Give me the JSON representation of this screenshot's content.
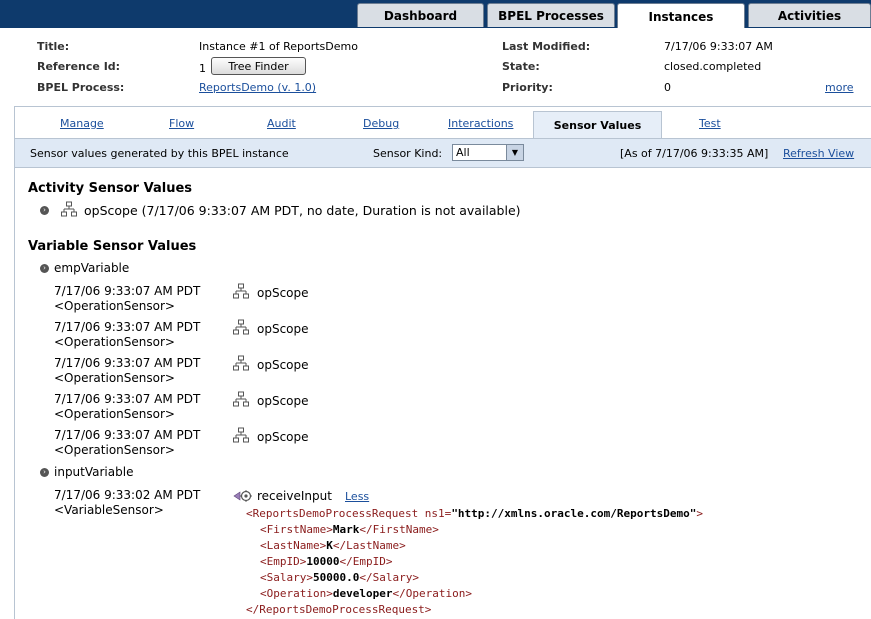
{
  "top_tabs": [
    {
      "label": "Dashboard"
    },
    {
      "label": "BPEL Processes"
    },
    {
      "label": "Instances"
    },
    {
      "label": "Activities"
    }
  ],
  "header": {
    "title_label": "Title:",
    "title_value": "Instance #1 of ReportsDemo",
    "ref_label": "Reference Id:",
    "ref_value": "1",
    "tree_finder": "Tree Finder",
    "process_label": "BPEL Process:",
    "process_value": "ReportsDemo (v. 1.0)",
    "modified_label": "Last Modified:",
    "modified_value": "7/17/06 9:33:07 AM",
    "state_label": "State:",
    "state_value": "closed.completed",
    "priority_label": "Priority:",
    "priority_value": "0",
    "more": "more"
  },
  "sub_tabs": [
    {
      "label": "Manage"
    },
    {
      "label": "Flow"
    },
    {
      "label": "Audit"
    },
    {
      "label": "Debug"
    },
    {
      "label": "Interactions"
    },
    {
      "label": "Sensor Values"
    },
    {
      "label": "Test"
    }
  ],
  "info": {
    "description": "Sensor values generated by this BPEL instance",
    "kind_label": "Sensor Kind:",
    "kind_value": "All",
    "as_of": "[As of 7/17/06 9:33:35 AM]",
    "refresh": "Refresh View"
  },
  "activity_section": {
    "heading": "Activity Sensor Values",
    "item": "opScope (7/17/06 9:33:07 AM PDT, no date, Duration is not available)"
  },
  "variable_section": {
    "heading": "Variable Sensor Values",
    "emp_var": "empVariable",
    "emp_rows": [
      {
        "time": "7/17/06 9:33:07 AM PDT",
        "type": "<OperationSensor>",
        "scope": "opScope"
      },
      {
        "time": "7/17/06 9:33:07 AM PDT",
        "type": "<OperationSensor>",
        "scope": "opScope"
      },
      {
        "time": "7/17/06 9:33:07 AM PDT",
        "type": "<OperationSensor>",
        "scope": "opScope"
      },
      {
        "time": "7/17/06 9:33:07 AM PDT",
        "type": "<OperationSensor>",
        "scope": "opScope"
      },
      {
        "time": "7/17/06 9:33:07 AM PDT",
        "type": "<OperationSensor>",
        "scope": "opScope"
      }
    ],
    "input_var": "inputVariable",
    "input_row": {
      "time": "7/17/06 9:33:02 AM PDT",
      "type": "<VariableSensor>",
      "activity": "receiveInput",
      "less": "Less"
    }
  },
  "xml": {
    "open_tag": "<ReportsDemoProcessRequest ns1=",
    "ns_value": "\"http://xmlns.oracle.com/ReportsDemo\"",
    "open_close": ">",
    "first_open": "<FirstName>",
    "first_val": "Mark",
    "first_close": "</FirstName>",
    "last_open": "<LastName>",
    "last_val": "K",
    "last_close": "</LastName>",
    "emp_open": "<EmpID>",
    "emp_val": "10000",
    "emp_close": "</EmpID>",
    "sal_open": "<Salary>",
    "sal_val": "50000.0",
    "sal_close": "</Salary>",
    "op_open": "<Operation>",
    "op_val": "developer",
    "op_close": "</Operation>",
    "close_tag": "</ReportsDemoProcessRequest>"
  }
}
